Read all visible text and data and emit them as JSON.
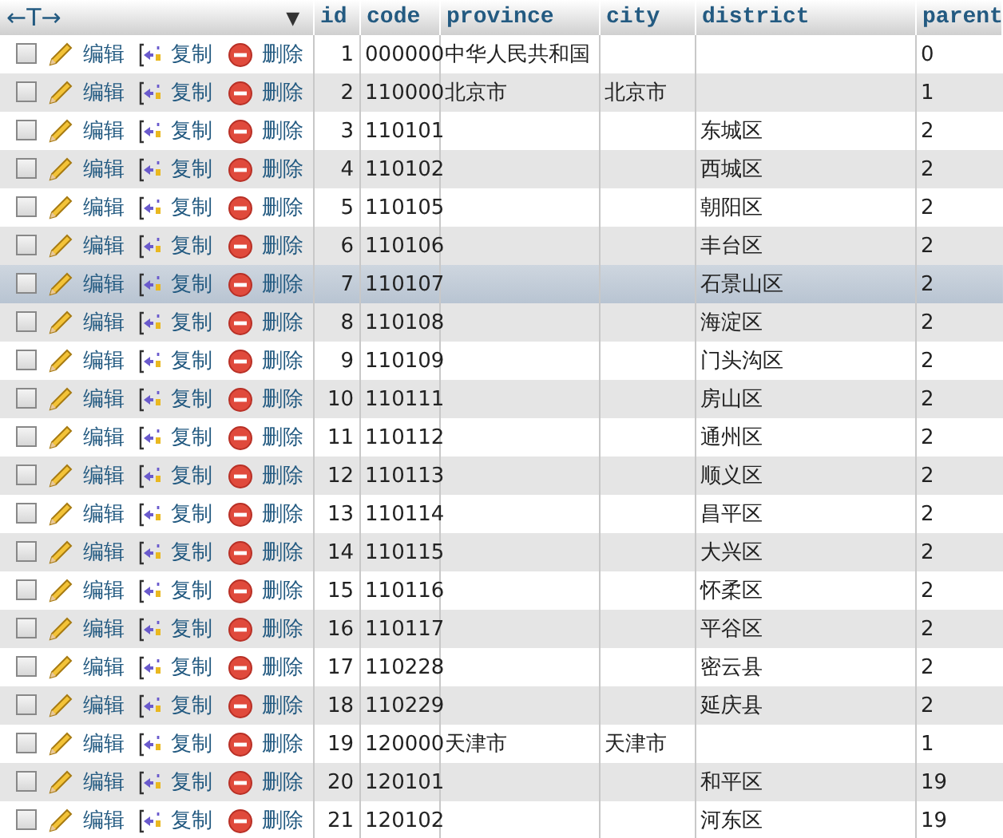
{
  "header": {
    "column_toggle": "←T→",
    "sort_caret": "▼",
    "columns": [
      "id",
      "code",
      "province",
      "city",
      "district",
      "parent"
    ]
  },
  "rows": [
    {
      "checked": false,
      "highlighted": false,
      "edit": "编辑",
      "copy": "复制",
      "delete": "删除",
      "id": "1",
      "code": "000000",
      "province": "中华人民共和国",
      "parent": "0"
    },
    {
      "checked": false,
      "highlighted": false,
      "edit": "编辑",
      "copy": "复制",
      "delete": "删除",
      "id": "2",
      "code": "110000",
      "province": "北京市",
      "city": "北京市",
      "parent": "1"
    },
    {
      "checked": false,
      "highlighted": false,
      "edit": "编辑",
      "copy": "复制",
      "delete": "删除",
      "id": "3",
      "code": "110101",
      "district": "东城区",
      "parent": "2"
    },
    {
      "checked": false,
      "highlighted": false,
      "edit": "编辑",
      "copy": "复制",
      "delete": "删除",
      "id": "4",
      "code": "110102",
      "district": "西城区",
      "parent": "2"
    },
    {
      "checked": false,
      "highlighted": false,
      "edit": "编辑",
      "copy": "复制",
      "delete": "删除",
      "id": "5",
      "code": "110105",
      "district": "朝阳区",
      "parent": "2"
    },
    {
      "checked": false,
      "highlighted": false,
      "edit": "编辑",
      "copy": "复制",
      "delete": "删除",
      "id": "6",
      "code": "110106",
      "district": "丰台区",
      "parent": "2"
    },
    {
      "checked": false,
      "highlighted": true,
      "edit": "编辑",
      "copy": "复制",
      "delete": "删除",
      "id": "7",
      "code": "110107",
      "district": "石景山区",
      "parent": "2"
    },
    {
      "checked": false,
      "highlighted": false,
      "edit": "编辑",
      "copy": "复制",
      "delete": "删除",
      "id": "8",
      "code": "110108",
      "district": "海淀区",
      "parent": "2"
    },
    {
      "checked": false,
      "highlighted": false,
      "edit": "编辑",
      "copy": "复制",
      "delete": "删除",
      "id": "9",
      "code": "110109",
      "district": "门头沟区",
      "parent": "2"
    },
    {
      "checked": false,
      "highlighted": false,
      "edit": "编辑",
      "copy": "复制",
      "delete": "删除",
      "id": "10",
      "code": "110111",
      "district": "房山区",
      "parent": "2"
    },
    {
      "checked": false,
      "highlighted": false,
      "edit": "编辑",
      "copy": "复制",
      "delete": "删除",
      "id": "11",
      "code": "110112",
      "district": "通州区",
      "parent": "2"
    },
    {
      "checked": false,
      "highlighted": false,
      "edit": "编辑",
      "copy": "复制",
      "delete": "删除",
      "id": "12",
      "code": "110113",
      "district": "顺义区",
      "parent": "2"
    },
    {
      "checked": false,
      "highlighted": false,
      "edit": "编辑",
      "copy": "复制",
      "delete": "删除",
      "id": "13",
      "code": "110114",
      "district": "昌平区",
      "parent": "2"
    },
    {
      "checked": false,
      "highlighted": false,
      "edit": "编辑",
      "copy": "复制",
      "delete": "删除",
      "id": "14",
      "code": "110115",
      "district": "大兴区",
      "parent": "2"
    },
    {
      "checked": false,
      "highlighted": false,
      "edit": "编辑",
      "copy": "复制",
      "delete": "删除",
      "id": "15",
      "code": "110116",
      "district": "怀柔区",
      "parent": "2"
    },
    {
      "checked": false,
      "highlighted": false,
      "edit": "编辑",
      "copy": "复制",
      "delete": "删除",
      "id": "16",
      "code": "110117",
      "district": "平谷区",
      "parent": "2"
    },
    {
      "checked": false,
      "highlighted": false,
      "edit": "编辑",
      "copy": "复制",
      "delete": "删除",
      "id": "17",
      "code": "110228",
      "district": "密云县",
      "parent": "2"
    },
    {
      "checked": false,
      "highlighted": false,
      "edit": "编辑",
      "copy": "复制",
      "delete": "删除",
      "id": "18",
      "code": "110229",
      "district": "延庆县",
      "parent": "2"
    },
    {
      "checked": false,
      "highlighted": false,
      "edit": "编辑",
      "copy": "复制",
      "delete": "删除",
      "id": "19",
      "code": "120000",
      "province": "天津市",
      "city": "天津市",
      "parent": "1"
    },
    {
      "checked": false,
      "highlighted": false,
      "edit": "编辑",
      "copy": "复制",
      "delete": "删除",
      "id": "20",
      "code": "120101",
      "district": "和平区",
      "parent": "19"
    },
    {
      "checked": false,
      "highlighted": false,
      "edit": "编辑",
      "copy": "复制",
      "delete": "删除",
      "id": "21",
      "code": "120102",
      "district": "河东区",
      "parent": "19"
    }
  ]
}
